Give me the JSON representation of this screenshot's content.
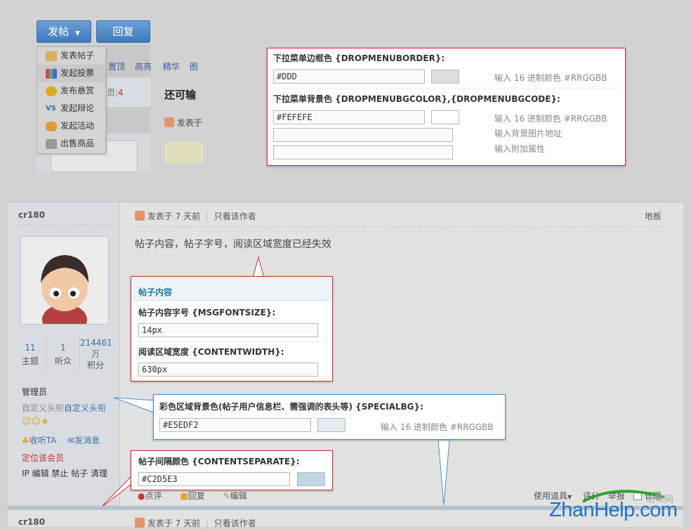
{
  "toolbar": {
    "post_button": "发帖",
    "reply_button": "回复"
  },
  "dropdown": {
    "items": [
      "发表帖子",
      "发起投票",
      "发布悬赏",
      "发起辩论",
      "发起活动",
      "出售商品"
    ]
  },
  "filters": [
    "置顶",
    "高亮",
    "精华",
    "图"
  ],
  "thread_preview": {
    "title": "还可输",
    "posted": "发表于",
    "page_fragment": "页:",
    "page_num": "4"
  },
  "panel_dropdown": {
    "border_title": "下拉菜单边框色 {DROPMENUBORDER}:",
    "border_value": "#DDD",
    "border_swatch": "#DDDDDD",
    "hex_hint": "输入 16 进制颜色 #RRGGBB",
    "bg_title": "下拉菜单背景色 {DROPMENUBGCOLOR},{DROPMENUBGCODE}:",
    "bg_value": "#FEFEFE",
    "bg_swatch": "#FEFEFE",
    "bg_hint1": "输入 16 进制颜色 #RRGGBB",
    "bg_hint2": "输入背景图片地址",
    "bg_hint3": "输入附加属性"
  },
  "post": {
    "author": "cr180",
    "posted_ago": "发表于 7 天前",
    "only_author": "只看该作者",
    "floor": "地板",
    "content": "帖子内容，帖子字号，阅读区域宽度已经失效",
    "stats": [
      {
        "num": "11",
        "label": "主题"
      },
      {
        "num": "1",
        "label": "听众"
      },
      {
        "num": "214461万",
        "label": "积分"
      }
    ],
    "group": "管理员",
    "custom_title": "自定义头衔",
    "custom_title2": "自定义头衔",
    "follow": "收听TA",
    "message": "发消息",
    "locate": "定位该会员",
    "admin_links": "IP 编辑 禁止 帖子 清理",
    "actions": [
      "点评",
      "回复",
      "编辑"
    ],
    "right_actions": [
      "使用道具",
      "评分",
      "举报",
      "管理"
    ],
    "next_author": "cr180",
    "next_posted": "发表于 7 天前",
    "next_only": "只看该作者"
  },
  "panel_content": {
    "header": "帖子内容",
    "font_title": "帖子内容字号 {MSGFONTSIZE}:",
    "font_value": "14px",
    "width_title": "阅读区域宽度 {CONTENTWIDTH}:",
    "width_value": "630px"
  },
  "panel_special": {
    "title": "彩色区域背景色(帖子用户信息栏、需强调的表头等) {SPECIALBG}:",
    "value": "#E5EDF2",
    "swatch": "#E5EDF2",
    "hint": "输入 16 进制颜色 #RRGGBB"
  },
  "panel_separate": {
    "title": "帖子间隔颜色 {CONTENTSEPARATE}:",
    "value": "#C2D5E3",
    "swatch": "#C2D5E3"
  },
  "watermark": {
    "text": "ZhanHelp.com",
    "cn": "站帮网"
  }
}
